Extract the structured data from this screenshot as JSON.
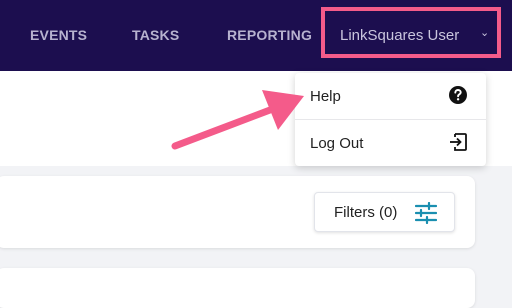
{
  "nav": {
    "items": [
      {
        "label": "EVENTS"
      },
      {
        "label": "TASKS"
      },
      {
        "label": "REPORTING"
      }
    ],
    "user": {
      "name": "LinkSquares User",
      "chevron": "⌄"
    }
  },
  "dropdown": {
    "items": [
      {
        "label": "Help",
        "icon": "help-circle-icon"
      },
      {
        "label": "Log Out",
        "icon": "logout-icon"
      }
    ]
  },
  "filters": {
    "label": "Filters (0)",
    "icon": "sliders-icon"
  },
  "colors": {
    "nav_bg": "#1c0e4f",
    "highlight": "#f45b8a",
    "accent": "#1a8fb0"
  }
}
